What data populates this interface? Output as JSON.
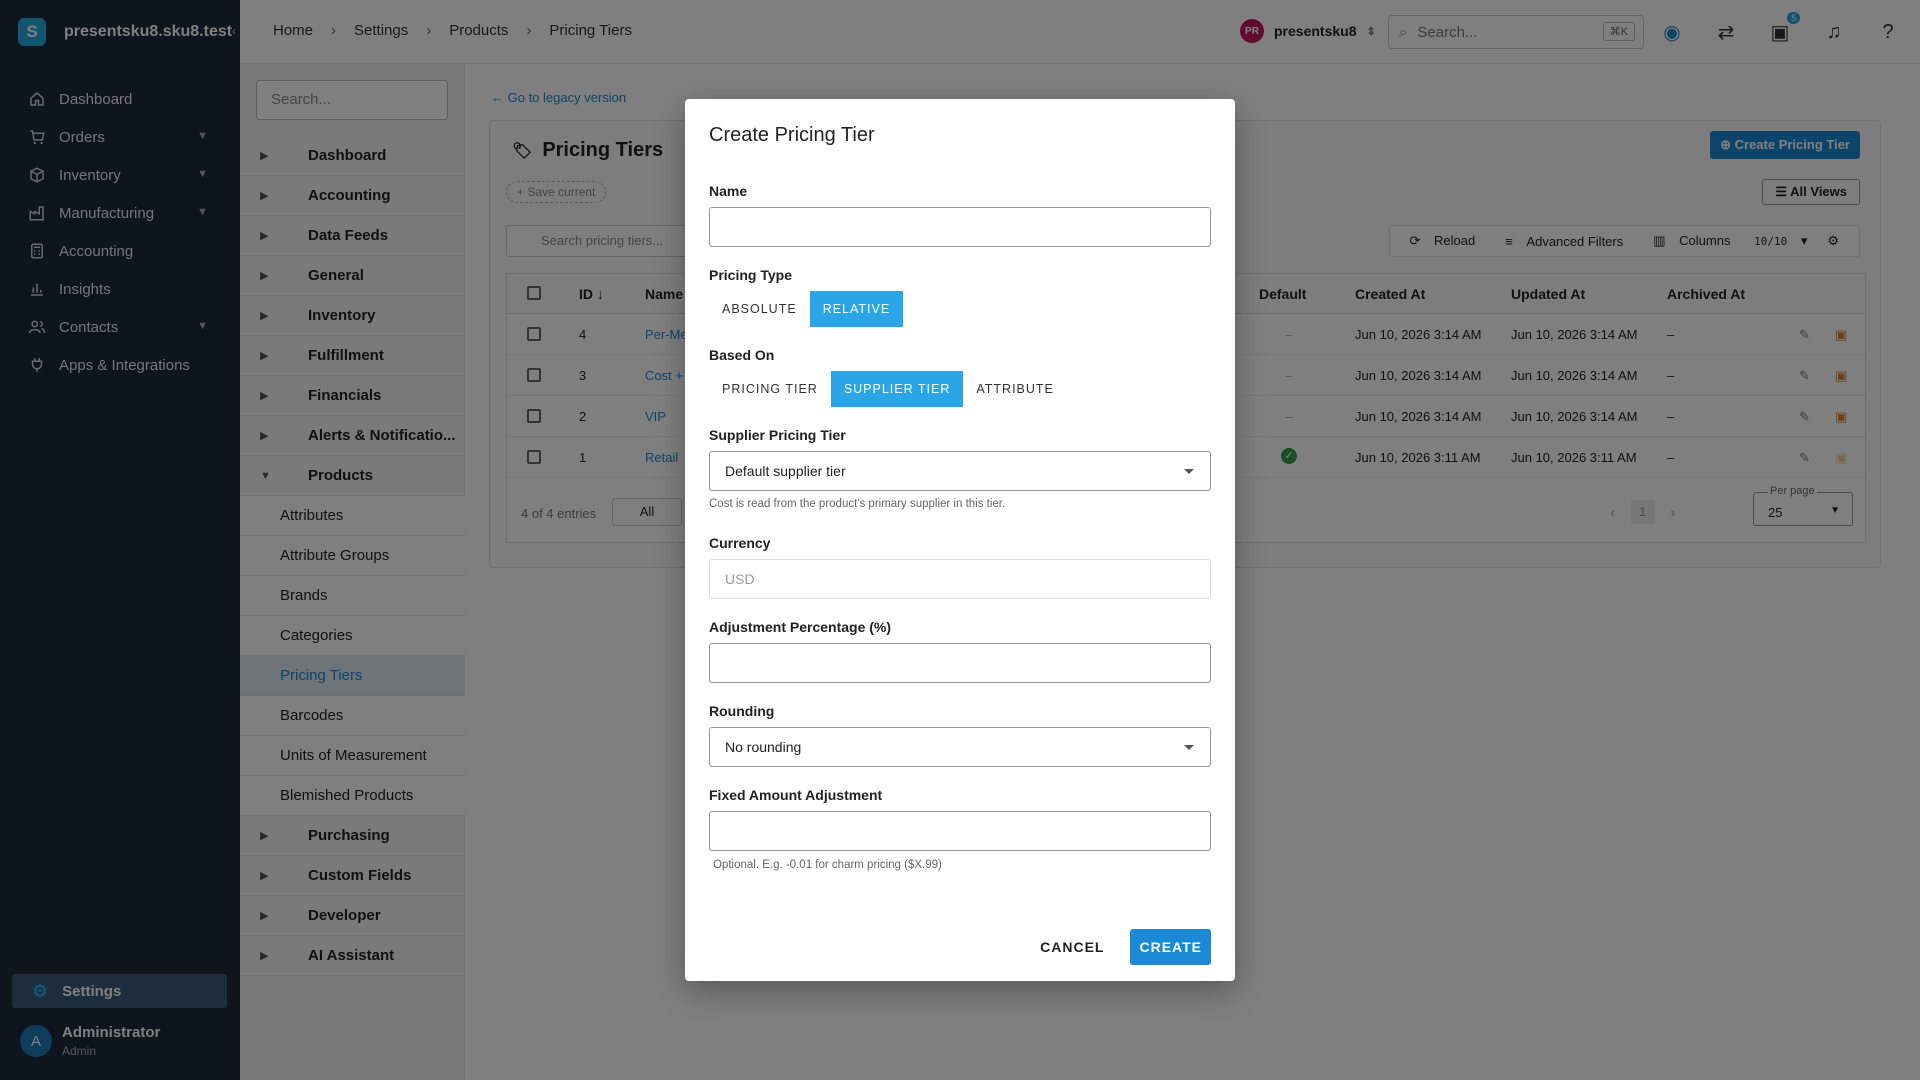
{
  "brand": {
    "logo": "S",
    "name": "presentsku8.sku8.test"
  },
  "sidebar": {
    "items": [
      {
        "label": "Dashboard",
        "icon": "home-icon",
        "expandable": false
      },
      {
        "label": "Orders",
        "icon": "cart-icon",
        "expandable": true
      },
      {
        "label": "Inventory",
        "icon": "box-icon",
        "expandable": true
      },
      {
        "label": "Manufacturing",
        "icon": "factory-icon",
        "expandable": true
      },
      {
        "label": "Accounting",
        "icon": "calculator-icon",
        "expandable": false
      },
      {
        "label": "Insights",
        "icon": "chart-icon",
        "expandable": false
      },
      {
        "label": "Contacts",
        "icon": "people-icon",
        "expandable": true
      },
      {
        "label": "Apps & Integrations",
        "icon": "plug-icon",
        "expandable": false
      }
    ],
    "settings_label": "Settings",
    "user": {
      "initial": "A",
      "name": "Administrator",
      "role": "Admin"
    }
  },
  "topbar": {
    "breadcrumbs": [
      "Home",
      "Settings",
      "Products",
      "Pricing Tiers"
    ],
    "account_initials": "PR",
    "account_name": "presentsku8",
    "search_placeholder": "Search...",
    "search_shortcut": "⌘K",
    "notifications_badge": "5"
  },
  "settings_menu": {
    "search_placeholder": "Search...",
    "items": [
      {
        "label": "Dashboard",
        "open": false
      },
      {
        "label": "Accounting",
        "open": false
      },
      {
        "label": "Data Feeds",
        "open": false
      },
      {
        "label": "General",
        "open": false
      },
      {
        "label": "Inventory",
        "open": false
      },
      {
        "label": "Fulfillment",
        "open": false
      },
      {
        "label": "Financials",
        "open": false
      },
      {
        "label": "Alerts & Notificatio...",
        "open": false
      },
      {
        "label": "Products",
        "open": true
      }
    ],
    "products_children": [
      "Attributes",
      "Attribute Groups",
      "Brands",
      "Categories",
      "Pricing Tiers",
      "Barcodes",
      "Units of Measurement",
      "Blemished Products"
    ],
    "after_items": [
      "Purchasing",
      "Custom Fields",
      "Developer",
      "AI Assistant"
    ]
  },
  "page": {
    "legacy_link": "← Go to legacy version",
    "title": "Pricing Tiers",
    "create_button": "Create Pricing Tier",
    "save_current": "+ Save current",
    "all_views": "All Views",
    "table_search_placeholder": "Search pricing tiers...",
    "tools": {
      "reload": "Reload",
      "filters": "Advanced Filters",
      "columns": "Columns",
      "columns_count": "10/10"
    },
    "columns": [
      "ID",
      "Name",
      "Default",
      "Created At",
      "Updated At",
      "Archived At"
    ],
    "rows": [
      {
        "id": "4",
        "name": "Per-Me",
        "default": "–",
        "created": "Jun 10, 2026 3:14 AM",
        "updated": "Jun 10, 2026 3:14 AM",
        "archived": "–"
      },
      {
        "id": "3",
        "name": "Cost +",
        "default": "–",
        "created": "Jun 10, 2026 3:14 AM",
        "updated": "Jun 10, 2026 3:14 AM",
        "archived": "–"
      },
      {
        "id": "2",
        "name": "VIP",
        "default": "–",
        "created": "Jun 10, 2026 3:14 AM",
        "updated": "Jun 10, 2026 3:14 AM",
        "archived": "–"
      },
      {
        "id": "1",
        "name": "Retail",
        "default": "check",
        "created": "Jun 10, 2026 3:11 AM",
        "updated": "Jun 10, 2026 3:11 AM",
        "archived": "–"
      }
    ],
    "entries_text": "4 of 4 entries",
    "all_btn": "All",
    "page_number": "1",
    "per_page_label": "Per page",
    "per_page_value": "25"
  },
  "modal": {
    "title": "Create Pricing Tier",
    "name_label": "Name",
    "name_value": "",
    "pricing_type_label": "Pricing Type",
    "pricing_type_options": [
      "ABSOLUTE",
      "RELATIVE"
    ],
    "pricing_type_selected": "RELATIVE",
    "based_on_label": "Based On",
    "based_on_options": [
      "PRICING TIER",
      "SUPPLIER TIER",
      "ATTRIBUTE"
    ],
    "based_on_selected": "SUPPLIER TIER",
    "supplier_tier_label": "Supplier Pricing Tier",
    "supplier_tier_value": "Default supplier tier",
    "supplier_tier_helper": "Cost is read from the product's primary supplier in this tier.",
    "currency_label": "Currency",
    "currency_value": "USD",
    "adjustment_label": "Adjustment Percentage (%)",
    "adjustment_value": "",
    "rounding_label": "Rounding",
    "rounding_value": "No rounding",
    "fixed_label": "Fixed Amount Adjustment",
    "fixed_value": "",
    "fixed_helper": "Optional. E.g. -0.01 for charm pricing ($X.99)",
    "cancel_label": "CANCEL",
    "create_label": "CREATE"
  },
  "colors": {
    "accent": "#1a8ad4",
    "segment_on": "#29a5e8",
    "sidebar_bg": "#1e2b3a"
  }
}
